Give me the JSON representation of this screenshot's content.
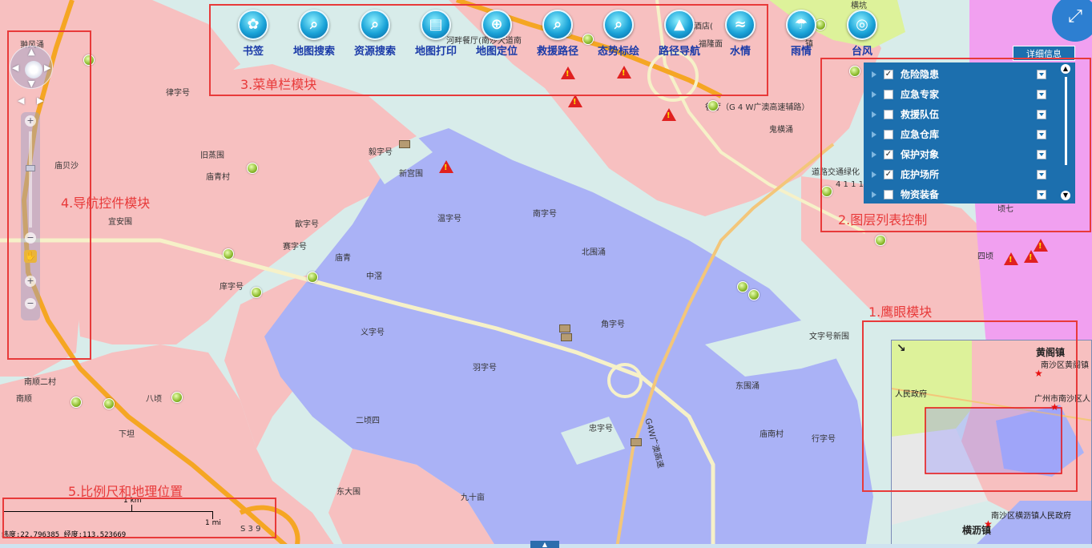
{
  "map": {
    "places": [
      {
        "id": "cuifengyong",
        "text": "翀风涌"
      },
      {
        "id": "luzihao",
        "text": "律字号"
      },
      {
        "id": "jiuchengwei",
        "text": "旧蒸围"
      },
      {
        "id": "miaoqingcun",
        "text": "庙青村"
      },
      {
        "id": "miaobeisha",
        "text": "庙贝沙"
      },
      {
        "id": "yizihao_top",
        "text": "毅字号"
      },
      {
        "id": "xinguanwei",
        "text": "新宫围"
      },
      {
        "id": "yiananwei",
        "text": "宜安围"
      },
      {
        "id": "wenzihao",
        "text": "温字号"
      },
      {
        "id": "qinzihao",
        "text": "歆字号"
      },
      {
        "id": "saizihao",
        "text": "赛字号"
      },
      {
        "id": "miaoqing",
        "text": "庙青"
      },
      {
        "id": "zhongjing",
        "text": "中滘"
      },
      {
        "id": "nanzihao",
        "text": "南字号"
      },
      {
        "id": "beiwei",
        "text": "北围涌"
      },
      {
        "id": "xuzihao",
        "text": "庠字号"
      },
      {
        "id": "yizihao",
        "text": "义字号"
      },
      {
        "id": "yuzihao",
        "text": "羽字号"
      },
      {
        "id": "jiaozihao",
        "text": "角字号"
      },
      {
        "id": "wenzihaoxinwei",
        "text": "文字号新围"
      },
      {
        "id": "dongwei",
        "text": "东围涌"
      },
      {
        "id": "nanshun2",
        "text": "南顺二村"
      },
      {
        "id": "nanshun",
        "text": "南顺"
      },
      {
        "id": "baqing",
        "text": "八顷"
      },
      {
        "id": "erqingsi",
        "text": "二顷四"
      },
      {
        "id": "xiaqi",
        "text": "下坦"
      },
      {
        "id": "zhongzihao",
        "text": "忠字号"
      },
      {
        "id": "miaonancun",
        "text": "庙南村"
      },
      {
        "id": "xingzihao",
        "text": "行字号"
      },
      {
        "id": "dongdawei",
        "text": "东大围"
      },
      {
        "id": "jiushiwei",
        "text": "九十亩"
      },
      {
        "id": "guichong",
        "text": "鬼横涌"
      },
      {
        "id": "siqing",
        "text": "四顷"
      },
      {
        "id": "qiqi",
        "text": "顷七"
      },
      {
        "id": "road_canteen",
        "text": "河畔餐厅(南沙大道南"
      },
      {
        "id": "dishroom",
        "text": "餐厅（G 4 W广澳高速辅路）"
      },
      {
        "id": "roadgreen",
        "text": "道路交通绿化"
      },
      {
        "id": "hotel",
        "text": "酒店("
      },
      {
        "id": "fulong",
        "text": "福隆面"
      },
      {
        "id": "g4w",
        "text": "G4W广澳高速"
      },
      {
        "id": "s39",
        "text": "S 3 9"
      },
      {
        "id": "zhen",
        "text": "镇"
      },
      {
        "id": "hengke",
        "text": "横坑"
      },
      {
        "id": "num4111",
        "text": "4 1 1 1"
      }
    ]
  },
  "menubar": {
    "items": [
      {
        "label": "书签",
        "icon": "maple-leaf-icon",
        "glyph": "✿"
      },
      {
        "label": "地图搜索",
        "icon": "map-search-icon",
        "glyph": "⌕"
      },
      {
        "label": "资源搜索",
        "icon": "resource-search-icon",
        "glyph": "⌕"
      },
      {
        "label": "地图打印",
        "icon": "printer-icon",
        "glyph": "▤"
      },
      {
        "label": "地图定位",
        "icon": "crosshair-icon",
        "glyph": "⊕"
      },
      {
        "label": "救援路径",
        "icon": "route-search-icon",
        "glyph": "⌕"
      },
      {
        "label": "态势标绘",
        "icon": "plot-icon",
        "glyph": "⌕"
      },
      {
        "label": "路径导航",
        "icon": "navigation-arrow-icon",
        "glyph": "▲"
      },
      {
        "label": "水情",
        "icon": "water-icon",
        "glyph": "≈"
      },
      {
        "label": "雨情",
        "icon": "rain-cloud-icon",
        "glyph": "☂"
      },
      {
        "label": "台风",
        "icon": "typhoon-icon",
        "glyph": "◎"
      }
    ]
  },
  "layer_panel": {
    "detail_label": "详细信息",
    "layers": [
      {
        "label": "危险隐患",
        "checked": true,
        "mark": "✓"
      },
      {
        "label": "应急专家",
        "checked": false,
        "mark": ""
      },
      {
        "label": "救援队伍",
        "checked": false,
        "mark": ""
      },
      {
        "label": "应急仓库",
        "checked": false,
        "mark": ""
      },
      {
        "label": "保护对象",
        "checked": true,
        "mark": "✓"
      },
      {
        "label": "庇护场所",
        "checked": true,
        "mark": "✓"
      },
      {
        "label": "物资装备",
        "checked": false,
        "mark": ""
      }
    ]
  },
  "annotations": {
    "eagle": "1.鹰眼模块",
    "layers": "2.图层列表控制",
    "menu": "3.菜单栏模块",
    "nav": "4.导航控件模块",
    "scale": "5.比例尺和地理位置"
  },
  "eagle_eye": {
    "places": [
      {
        "id": "huangge",
        "text": "黄阁镇",
        "bold": true
      },
      {
        "id": "nansha_huangge",
        "text": "南沙区黄阁镇"
      },
      {
        "id": "renmin",
        "text": "人民政府"
      },
      {
        "id": "gz_nansha",
        "text": "广州市南沙区人"
      },
      {
        "id": "hengli_gov",
        "text": "南沙区横沥镇人民政府"
      },
      {
        "id": "hengli",
        "text": "横沥镇",
        "bold": true
      }
    ],
    "collapse_glyph": "↘"
  },
  "scale": {
    "km_label": "1 km",
    "mi_label": "1 mi",
    "coords": "纬度:22.796385  经度:113.523669"
  },
  "navigation": {
    "zoom_in": "+",
    "zoom_out": "−",
    "hand_glyph": "✋"
  },
  "fullscreen_glyph": "⤢",
  "bottom_tab_glyph": "▲",
  "colors": {
    "water": "#d8ecea",
    "land_pink": "#f7c0c0",
    "district_purple": "#aab2f6",
    "magenta_zone": "#f1a0f0",
    "green_zone": "#ddf29a",
    "highway_orange": "#f5a623",
    "annotation_red": "#e83a3a",
    "panel_blue": "#1c6fae"
  }
}
